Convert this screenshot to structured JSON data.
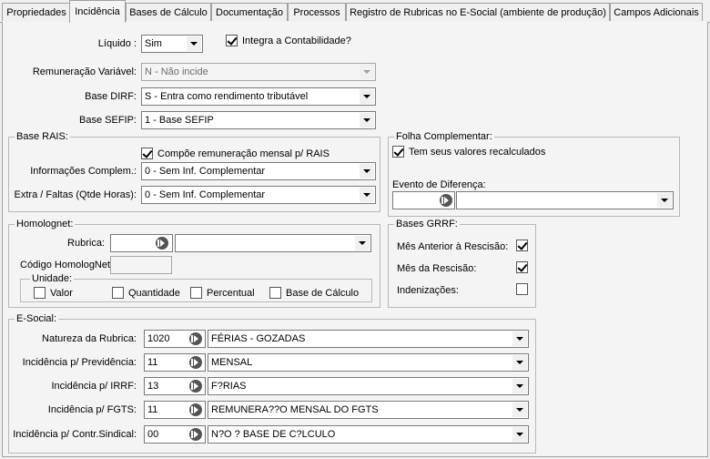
{
  "tabs": [
    {
      "label": "Propriedades"
    },
    {
      "label": "Incidência"
    },
    {
      "label": "Bases de Cálculo"
    },
    {
      "label": "Documentação"
    },
    {
      "label": "Processos"
    },
    {
      "label": "Registro de Rubricas no E-Social (ambiente de produção)"
    },
    {
      "label": "Campos Adicionais"
    }
  ],
  "main": {
    "liquido_label": "Líquido :",
    "liquido_value": "Sim",
    "integra_label": "Integra a Contabilidade?",
    "integra_checked": true,
    "remuneracao_label": "Remuneração Variável:",
    "remuneracao_value": "N - Não incide",
    "base_dirf_label": "Base DIRF:",
    "base_dirf_value": "S - Entra como rendimento tributável",
    "base_sefip_label": "Base SEFIP:",
    "base_sefip_value": "1 - Base SEFIP"
  },
  "rais": {
    "title": "Base RAIS:",
    "compoe_label": "Compõe remuneração mensal p/ RAIS",
    "compoe_checked": true,
    "info_label": "Informações Complem.:",
    "info_value": "0 - Sem Inf. Complementar",
    "extra_label": "Extra / Faltas (Qtde Horas):",
    "extra_value": "0 - Sem Inf. Complementar"
  },
  "folha": {
    "title": "Folha Complementar:",
    "recalc_label": "Tem seus valores recalculados",
    "recalc_checked": true,
    "evento_label": "Evento de Diferença:",
    "evento_code": "",
    "evento_desc": ""
  },
  "homolog": {
    "title": "Homolognet:",
    "rubrica_label": "Rubrica:",
    "rubrica_code": "",
    "rubrica_desc": "",
    "codigo_label": "Código HomologNet",
    "codigo_value": "",
    "unidade_title": "Unidade:",
    "valor_label": "Valor",
    "quantidade_label": "Quantidade",
    "percentual_label": "Percentual",
    "basecalc_label": "Base de Cálculo"
  },
  "grrf": {
    "title": "Bases GRRF:",
    "mes_anterior_label": "Mês Anterior à Rescisão:",
    "mes_anterior_checked": true,
    "mes_rescisao_label": "Mês da Rescisão:",
    "mes_rescisao_checked": true,
    "indenizacoes_label": "Indenizações:",
    "indenizacoes_checked": false
  },
  "esocial": {
    "title": "E-Social:",
    "rows": [
      {
        "label": "Natureza da Rubrica:",
        "code": "1020",
        "desc": "FÉRIAS - GOZADAS"
      },
      {
        "label": "Incidência p/ Previdência:",
        "code": "11",
        "desc": "MENSAL"
      },
      {
        "label": "Incidência p/ IRRF:",
        "code": "13",
        "desc": "F?RIAS"
      },
      {
        "label": "Incidência p/ FGTS:",
        "code": "11",
        "desc": "REMUNERA??O MENSAL DO FGTS"
      },
      {
        "label": "Incidência p/ Contr.Sindical:",
        "code": "00",
        "desc": "N?O ? BASE DE C?LCULO"
      }
    ]
  }
}
